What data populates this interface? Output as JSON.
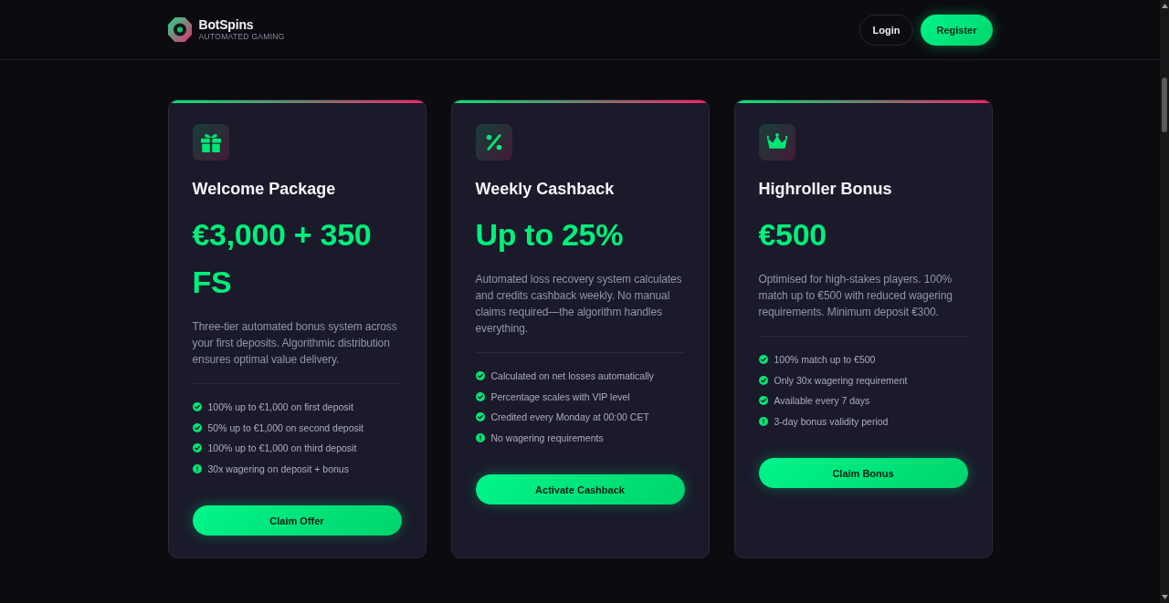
{
  "header": {
    "brand": "BotSpins",
    "tagline": "AUTOMATED GAMING",
    "buttons": [
      {
        "label": "Login",
        "kind": "outline"
      },
      {
        "label": "Register",
        "kind": "primary"
      }
    ]
  },
  "offers": [
    {
      "kind": "gift",
      "title": "Welcome Package",
      "amount": "€3,000 + 350 FS",
      "description": "Three-tier automated bonus system across your first deposits. Algorithmic distribution ensures optimal value delivery.",
      "features": [
        {
          "text": "100% up to €1,000 on first deposit",
          "kind": "check"
        },
        {
          "text": "50% up to €1,000 on second deposit",
          "kind": "check"
        },
        {
          "text": "100% up to €1,000 on third deposit",
          "kind": "check"
        },
        {
          "text": "30x wagering on deposit + bonus",
          "kind": "info"
        }
      ],
      "button": "Claim Offer"
    },
    {
      "kind": "percent",
      "title": "Weekly Cashback",
      "amount": "Up to 25%",
      "description": "Automated loss recovery system calculates and credits cashback weekly. No manual claims required—the algorithm handles everything.",
      "features": [
        {
          "text": "Calculated on net losses automatically",
          "kind": "check"
        },
        {
          "text": "Percentage scales with VIP level",
          "kind": "check"
        },
        {
          "text": "Credited every Monday at 00:00 CET",
          "kind": "check"
        },
        {
          "text": "No wagering requirements",
          "kind": "info"
        }
      ],
      "button": "Activate Cashback"
    },
    {
      "kind": "crown",
      "title": "Highroller Bonus",
      "amount": "€500",
      "description": "Optimised for high-stakes players. 100% match up to €500 with reduced wagering requirements. Minimum deposit €300.",
      "features": [
        {
          "text": "100% match up to €500",
          "kind": "check"
        },
        {
          "text": "Only 30x wagering requirement",
          "kind": "check"
        },
        {
          "text": "Available every 7 days",
          "kind": "check"
        },
        {
          "text": "3-day bonus validity period",
          "kind": "info"
        }
      ],
      "button": "Claim Bonus"
    }
  ]
}
